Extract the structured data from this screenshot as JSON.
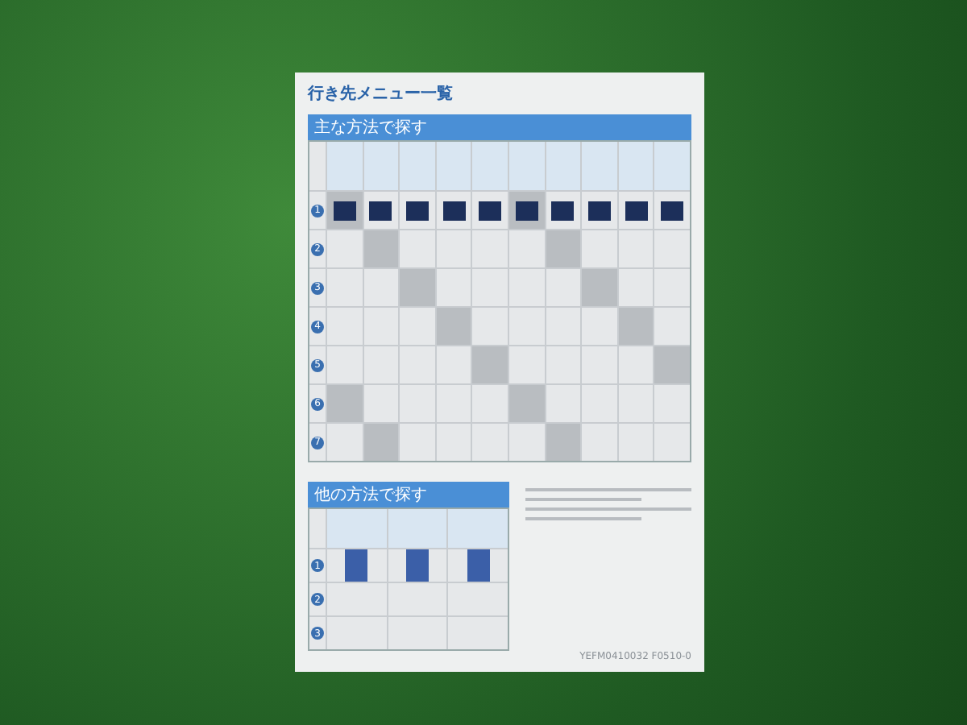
{
  "document": {
    "title": "行き先メニュー一覧",
    "main_section": {
      "heading": "主な方法で探す",
      "row_markers": [
        "1",
        "2",
        "3",
        "4",
        "5",
        "6",
        "7"
      ]
    },
    "other_section": {
      "heading": "他の方法で探す",
      "row_markers": [
        "1",
        "2",
        "3"
      ]
    },
    "footer_code": "YEFM0410032  F0510-0"
  }
}
